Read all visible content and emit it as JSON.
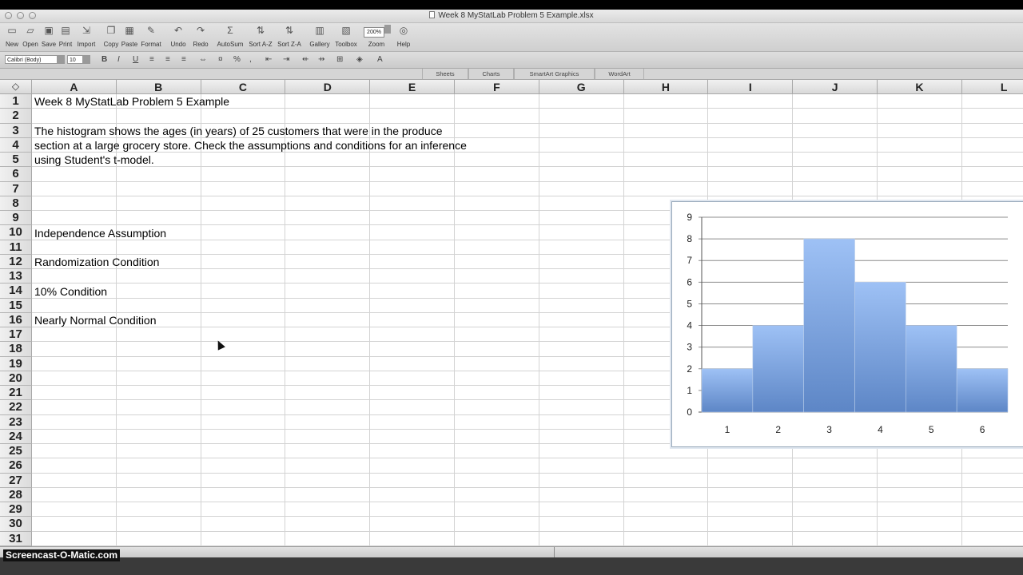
{
  "window": {
    "title": "Week 8 MyStatLab Problem 5 Example.xlsx"
  },
  "toolbar": {
    "buttons": [
      {
        "id": "new",
        "label": "New",
        "icon": "new-document-icon"
      },
      {
        "id": "open",
        "label": "Open",
        "icon": "folder-icon"
      },
      {
        "id": "save",
        "label": "Save",
        "icon": "floppy-icon"
      },
      {
        "id": "print",
        "label": "Print",
        "icon": "printer-icon"
      },
      {
        "id": "import",
        "label": "Import",
        "icon": "import-icon"
      },
      {
        "id": "copy",
        "label": "Copy",
        "icon": "copy-icon"
      },
      {
        "id": "paste",
        "label": "Paste",
        "icon": "paste-icon"
      },
      {
        "id": "format",
        "label": "Format",
        "icon": "brush-icon"
      },
      {
        "id": "undo",
        "label": "Undo",
        "icon": "undo-icon"
      },
      {
        "id": "redo",
        "label": "Redo",
        "icon": "redo-icon"
      },
      {
        "id": "autosum",
        "label": "AutoSum",
        "icon": "sigma-icon"
      },
      {
        "id": "sortaz",
        "label": "Sort A-Z",
        "icon": "sort-az-icon"
      },
      {
        "id": "sortza",
        "label": "Sort Z-A",
        "icon": "sort-za-icon"
      },
      {
        "id": "gallery",
        "label": "Gallery",
        "icon": "gallery-icon"
      },
      {
        "id": "toolbox",
        "label": "Toolbox",
        "icon": "toolbox-icon"
      },
      {
        "id": "zoom",
        "label": "Zoom",
        "icon": "zoom-icon"
      },
      {
        "id": "help",
        "label": "Help",
        "icon": "help-icon"
      }
    ],
    "zoom_value": "200%"
  },
  "format": {
    "font_name": "Calibri (Body)",
    "font_size": "10"
  },
  "ribbon_tabs": [
    "Sheets",
    "Charts",
    "SmartArt Graphics",
    "WordArt"
  ],
  "columns": [
    "A",
    "B",
    "C",
    "D",
    "E",
    "F",
    "G",
    "H",
    "I",
    "J",
    "K",
    "L"
  ],
  "rows": [
    "1",
    "2",
    "3",
    "4",
    "5",
    "6",
    "7",
    "8",
    "9",
    "10",
    "11",
    "12",
    "13",
    "14",
    "15",
    "16",
    "17",
    "18",
    "19",
    "20",
    "21",
    "22",
    "23",
    "24",
    "25",
    "26",
    "27",
    "28",
    "29",
    "30",
    "31"
  ],
  "cells": {
    "A1": "Week 8 MyStatLab Problem 5 Example",
    "A3": "The histogram shows the ages (in years) of 25 customers that were in the produce",
    "A4": "section at a large grocery store. Check the assumptions and conditions for an inference",
    "A5": "using Student's t-model.",
    "A10": "Independence Assumption",
    "A12": "Randomization Condition",
    "A14": "10% Condition",
    "A16": "Nearly Normal Condition"
  },
  "chart_data": {
    "type": "bar",
    "categories": [
      "1",
      "2",
      "3",
      "4",
      "5",
      "6"
    ],
    "values": [
      2,
      4,
      8,
      6,
      4,
      2
    ],
    "ylim": [
      0,
      9
    ],
    "yticks": [
      "0",
      "1",
      "2",
      "3",
      "4",
      "5",
      "6",
      "7",
      "8",
      "9"
    ],
    "grid": true,
    "bar_color": "#6f9ee8",
    "bar_gap": 0
  },
  "watermark": "Screencast-O-Matic.com"
}
